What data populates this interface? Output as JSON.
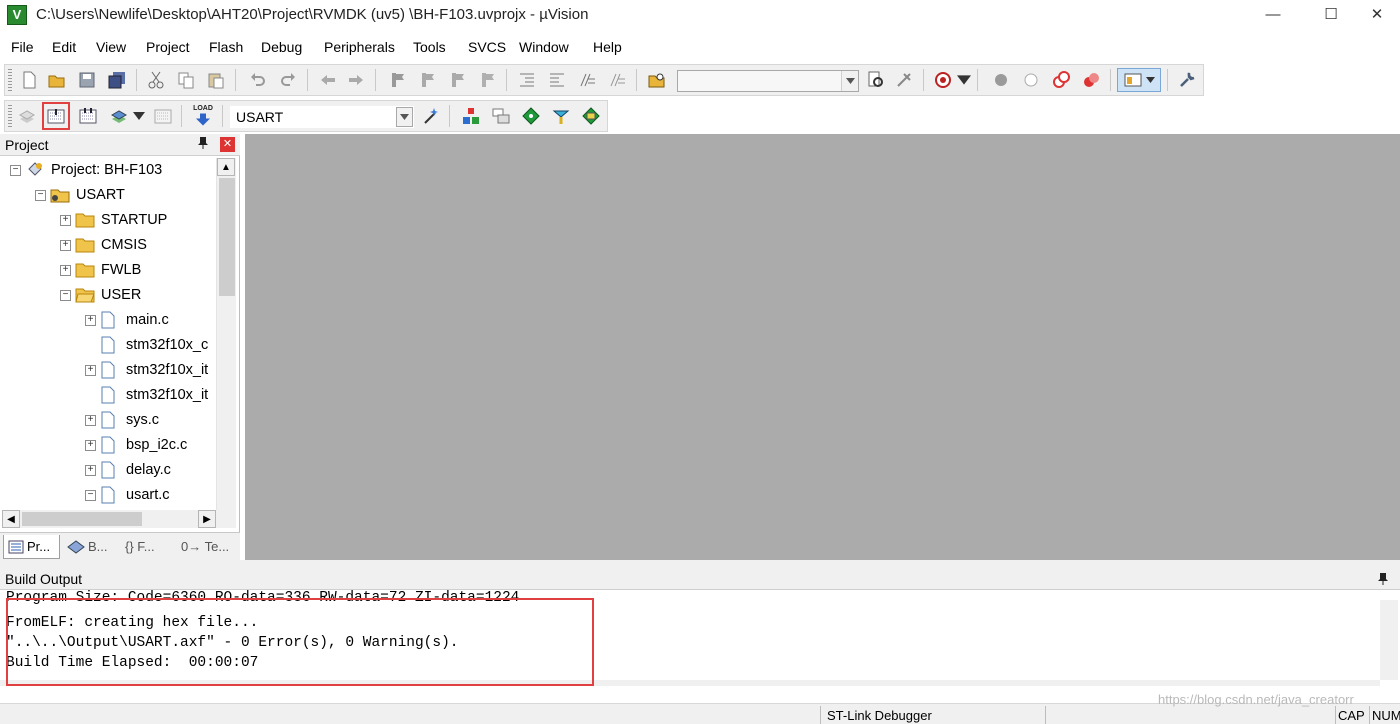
{
  "window": {
    "title": "C:\\Users\\Newlife\\Desktop\\AHT20\\Project\\RVMDK  (uv5)  \\BH-F103.uvprojx - µVision",
    "minimize": "—",
    "maximize": "☐",
    "close": "✕"
  },
  "menu": [
    "File",
    "Edit",
    "View",
    "Project",
    "Flash",
    "Debug",
    "Peripherals",
    "Tools",
    "SVCS",
    "Window",
    "Help"
  ],
  "toolbar2": {
    "target": "USART",
    "load_icon_text": "LOAD"
  },
  "project": {
    "title": "Project",
    "pin": "📌",
    "close": "✕",
    "tree": [
      {
        "label": "Project: BH-F103",
        "exp": "⊟"
      },
      {
        "label": "USART",
        "exp": "⊟"
      },
      {
        "label": "STARTUP",
        "exp": "⊞"
      },
      {
        "label": "CMSIS",
        "exp": "⊞"
      },
      {
        "label": "FWLB",
        "exp": "⊞"
      },
      {
        "label": "USER",
        "exp": "⊟"
      },
      {
        "label": "main.c",
        "exp": "⊞"
      },
      {
        "label": "stm32f10x_c",
        "exp": ""
      },
      {
        "label": "stm32f10x_it",
        "exp": "⊞"
      },
      {
        "label": "stm32f10x_it",
        "exp": ""
      },
      {
        "label": "sys.c",
        "exp": "⊞"
      },
      {
        "label": "bsp_i2c.c",
        "exp": "⊞"
      },
      {
        "label": "delay.c",
        "exp": "⊞"
      },
      {
        "label": "usart.c",
        "exp": "⊟"
      }
    ],
    "tabs": [
      "Pr...",
      "B...",
      "{} F...",
      "0→ Te..."
    ]
  },
  "build": {
    "title": "Build Output",
    "lines": [
      "Program Size: Code=6360 RO-data=336 RW-data=72 ZI-data=1224",
      "FromELF: creating hex file...",
      "\"..\\..\\Output\\USART.axf\" - 0 Error(s), 0 Warning(s).",
      "Build Time Elapsed:  00:00:07"
    ]
  },
  "status": {
    "debugger": "ST-Link Debugger",
    "cap": "CAP",
    "num": "NUM"
  },
  "watermark": "https://blog.csdn.net/java_creatorr",
  "colors": {
    "highlight_box": "#e04040",
    "editor_bg": "#ababab",
    "chrome": "#f0f0f0"
  }
}
